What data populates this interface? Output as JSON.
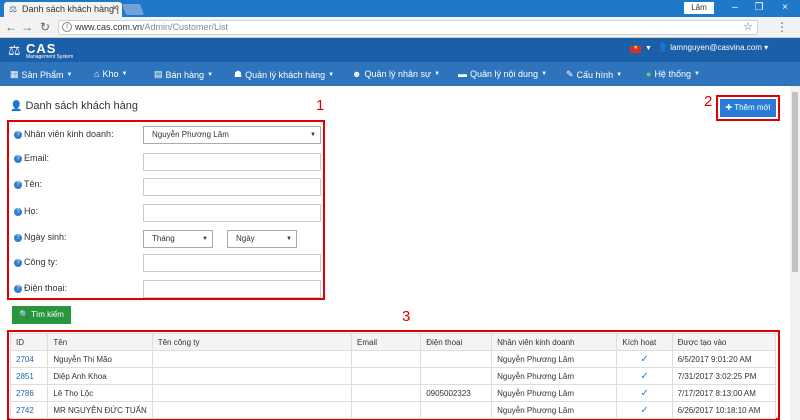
{
  "browser": {
    "tab_title": "Danh sách khách hàng |",
    "url_host": "www.cas.com.vn",
    "url_path": "/Admin/Customer/List",
    "window_user": "Lâm"
  },
  "header": {
    "brand": "CAS",
    "subtitle": "Management System",
    "user_email": "lamnguyen@casvina.com"
  },
  "nav": [
    {
      "label": "Sản Phẩm",
      "icon": "grid-icon"
    },
    {
      "label": "Kho",
      "icon": "house-icon"
    },
    {
      "label": "Bán hàng",
      "icon": "chart-icon"
    },
    {
      "label": "Quản lý khách hàng",
      "icon": "users-icon"
    },
    {
      "label": "Quản lý nhân sự",
      "icon": "staff-icon"
    },
    {
      "label": "Quản lý nội dung",
      "icon": "folder-icon"
    },
    {
      "label": "Cấu hình",
      "icon": "wrench-icon"
    },
    {
      "label": "Hệ thống",
      "icon": "globe-icon"
    }
  ],
  "page": {
    "title": "Danh sách khách hàng",
    "add_button": "Thêm mới",
    "search_button": "Tìm kiếm",
    "annotations": [
      "1",
      "2",
      "3"
    ]
  },
  "form": {
    "sales_staff_label": "Nhân viên kinh doanh:",
    "sales_staff_value": "Nguyễn Phương Lâm",
    "email_label": "Email:",
    "first_name_label": "Tên:",
    "last_name_label": "Họ:",
    "birthday_label": "Ngày sinh:",
    "month_value": "Tháng",
    "day_value": "Ngày",
    "company_label": "Công ty:",
    "phone_label": "Điện thoại:"
  },
  "table": {
    "headers": [
      "ID",
      "Tên",
      "Tên công ty",
      "Email",
      "Điện thoại",
      "Nhân viên kinh doanh",
      "Kích hoạt",
      "Được tạo vào"
    ],
    "rows": [
      [
        "2704",
        "Nguyễn Thị Mão",
        "",
        "",
        "",
        "Nguyễn Phương Lâm",
        "✓",
        "6/5/2017 9:01:20 AM"
      ],
      [
        "2851",
        "Diệp Anh Khoa",
        "",
        "",
        "",
        "Nguyễn Phương Lâm",
        "✓",
        "7/31/2017 3:02:25 PM"
      ],
      [
        "2786",
        "Lê Thọ Lộc",
        "",
        "",
        "0905002323",
        "Nguyễn Phương Lâm",
        "✓",
        "7/17/2017 8:13:00 AM"
      ],
      [
        "2742",
        "MR NGUYỄN ĐỨC TUẤN",
        "",
        "",
        "",
        "Nguyễn Phương Lâm",
        "✓",
        "6/26/2017 10:18:10 AM"
      ]
    ]
  }
}
